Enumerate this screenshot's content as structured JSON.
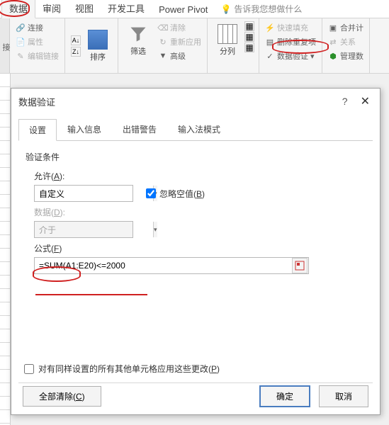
{
  "ribbon": {
    "tabs": [
      "数据",
      "审阅",
      "视图",
      "开发工具",
      "Power Pivot"
    ],
    "tellme": "告诉我您想做什么",
    "groups": {
      "connections": {
        "connect": "连接",
        "properties": "属性",
        "editlinks": "编辑链接"
      },
      "sort": {
        "sort": "排序"
      },
      "filter": {
        "filter": "筛选",
        "clear": "清除",
        "reapply": "重新应用",
        "advanced": "高级"
      },
      "datatools": {
        "textcolumns": "分列",
        "flashfill": "快速填充",
        "removedup": "删除重复项",
        "validation": "数据验证",
        "consolidate": "合并计",
        "relations": "关系",
        "manage": "管理数"
      }
    }
  },
  "dialog": {
    "title": "数据验证",
    "tabs": [
      "设置",
      "输入信息",
      "出错警告",
      "输入法模式"
    ],
    "section": "验证条件",
    "allow_label": "允许(A):",
    "allow_value": "自定义",
    "ignore_blank": "忽略空值(B)",
    "data_label": "数据(D):",
    "data_value": "介于",
    "formula_label": "公式(F)",
    "formula_value": "=SUM(A1:E20)<=2000",
    "apply_all": "对有同样设置的所有其他单元格应用这些更改(P)",
    "clear_all": "全部清除(C)",
    "ok": "确定",
    "cancel": "取消"
  }
}
